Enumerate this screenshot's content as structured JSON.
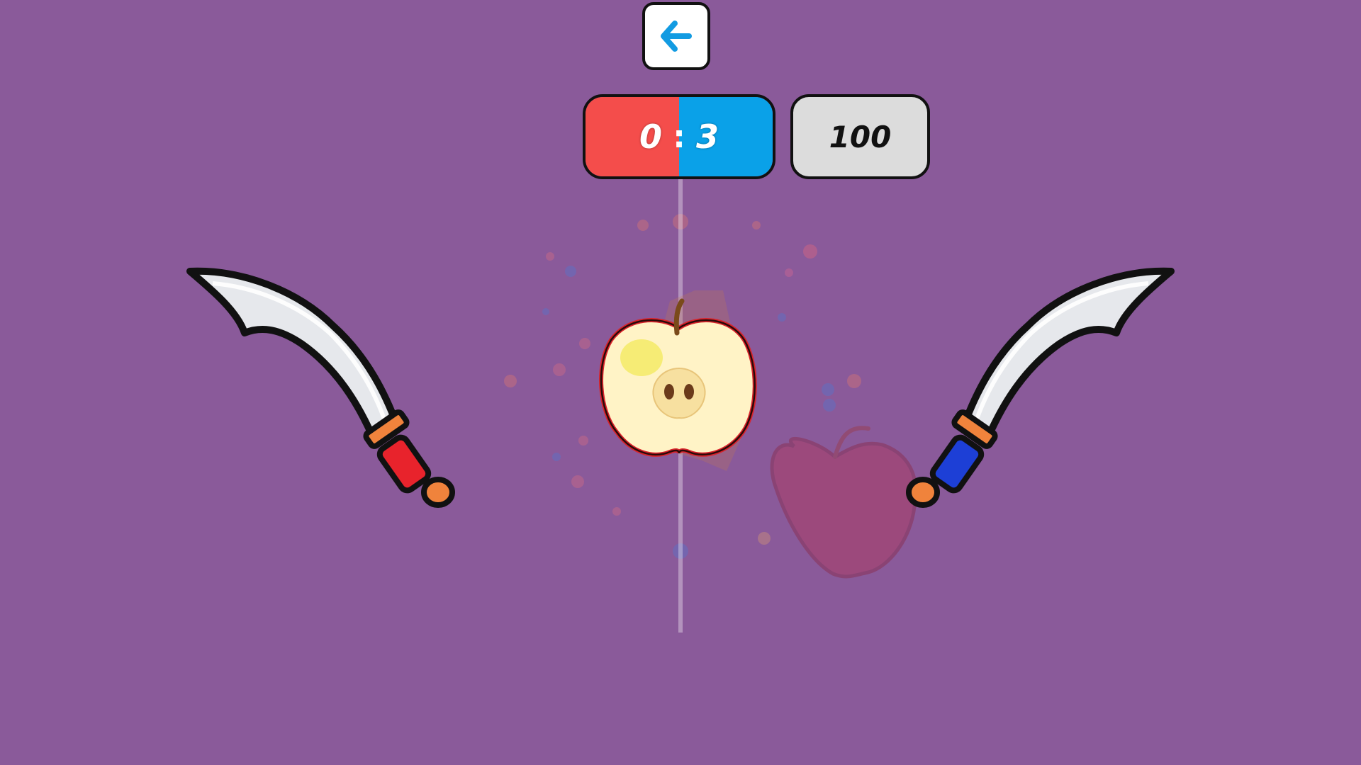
{
  "hud": {
    "back_button": {
      "icon": "arrow-left-icon",
      "color": "#129be2"
    },
    "score": {
      "red": "0",
      "separator": ":",
      "blue": "3",
      "red_color": "#f44d4b",
      "blue_color": "#0aa1e8"
    },
    "timer": "100"
  },
  "scene": {
    "background": "#8a5a9a",
    "sliced_fruit": "apple-half-icon",
    "ghost_fruit": "apple-icon",
    "left_knife": {
      "icon": "scimitar-icon",
      "handle_color": "#e8232c"
    },
    "right_knife": {
      "icon": "scimitar-icon",
      "handle_color": "#1d3fd6"
    }
  }
}
